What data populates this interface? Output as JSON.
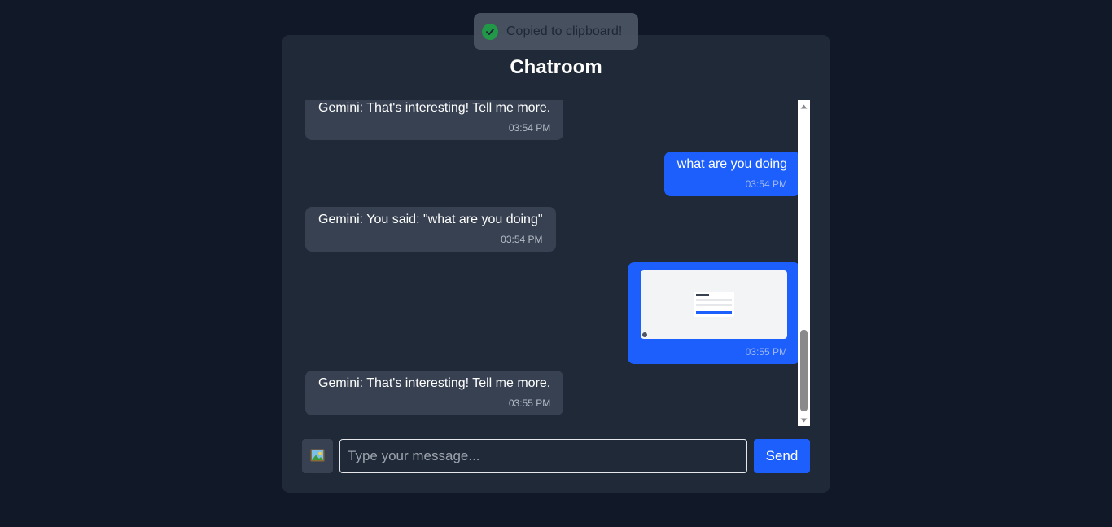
{
  "toast": {
    "text": "Copied to clipboard!",
    "icon": "check-circle-icon",
    "color": "#22a34a"
  },
  "chat": {
    "title": "Chatroom",
    "messages": [
      {
        "sender": "bot",
        "text": "Gemini: That's interesting! Tell me more.",
        "time": "03:54 PM"
      },
      {
        "sender": "user",
        "text": "what are you doing",
        "time": "03:54 PM"
      },
      {
        "sender": "bot",
        "text": "Gemini: You said: \"what are you doing\"",
        "time": "03:54 PM"
      },
      {
        "sender": "user",
        "type": "image",
        "time": "03:55 PM"
      },
      {
        "sender": "bot",
        "text": "Gemini: That's interesting! Tell me more.",
        "time": "03:55 PM"
      }
    ]
  },
  "input": {
    "placeholder": "Type your message...",
    "value": "",
    "image_button_icon": "image-icon",
    "send_label": "Send"
  },
  "colors": {
    "background": "#111827",
    "panel": "#1f2937",
    "bot_bubble": "#374151",
    "user_bubble": "#1d5ffc"
  }
}
